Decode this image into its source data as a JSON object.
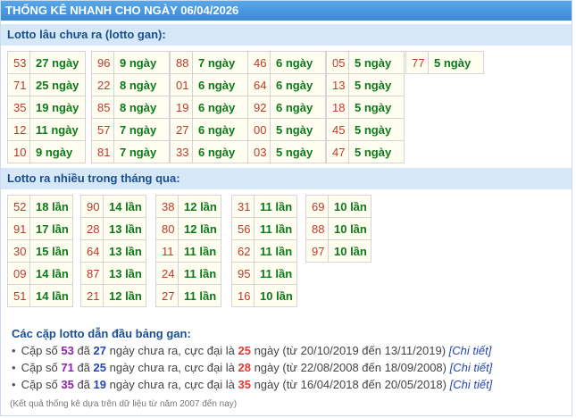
{
  "header": {
    "title": "THỐNG KÊ NHANH CHO NGÀY 06/04/2026"
  },
  "gan": {
    "heading": "Lotto lâu chưa ra (lotto gan):",
    "columns": [
      [
        {
          "num": "53",
          "val": "27 ngày"
        },
        {
          "num": "71",
          "val": "25 ngày"
        },
        {
          "num": "35",
          "val": "19 ngày"
        },
        {
          "num": "12",
          "val": "11 ngày"
        },
        {
          "num": "10",
          "val": "9 ngày"
        }
      ],
      [
        {
          "num": "96",
          "val": "9 ngày"
        },
        {
          "num": "22",
          "val": "8 ngày"
        },
        {
          "num": "85",
          "val": "8 ngày"
        },
        {
          "num": "57",
          "val": "7 ngày"
        },
        {
          "num": "81",
          "val": "7 ngày"
        }
      ],
      [
        {
          "num": "88",
          "val": "7 ngày"
        },
        {
          "num": "01",
          "val": "6 ngày"
        },
        {
          "num": "19",
          "val": "6 ngày"
        },
        {
          "num": "27",
          "val": "6 ngày"
        },
        {
          "num": "33",
          "val": "6 ngày"
        }
      ],
      [
        {
          "num": "46",
          "val": "6 ngày"
        },
        {
          "num": "64",
          "val": "6 ngày"
        },
        {
          "num": "92",
          "val": "6 ngày"
        },
        {
          "num": "00",
          "val": "5 ngày"
        },
        {
          "num": "03",
          "val": "5 ngày"
        }
      ],
      [
        {
          "num": "05",
          "val": "5 ngày"
        },
        {
          "num": "13",
          "val": "5 ngày"
        },
        {
          "num": "18",
          "val": "5 ngày"
        },
        {
          "num": "45",
          "val": "5 ngày"
        },
        {
          "num": "47",
          "val": "5 ngày"
        }
      ],
      [
        {
          "num": "77",
          "val": "5 ngày"
        }
      ]
    ]
  },
  "nhieu": {
    "heading": "Lotto ra nhiều trong tháng qua:",
    "columns": [
      [
        {
          "num": "52",
          "val": "18 lần"
        },
        {
          "num": "91",
          "val": "17 lần"
        },
        {
          "num": "30",
          "val": "15 lần"
        },
        {
          "num": "09",
          "val": "14 lần"
        },
        {
          "num": "51",
          "val": "14 lần"
        }
      ],
      [
        {
          "num": "90",
          "val": "14 lần"
        },
        {
          "num": "28",
          "val": "13 lần"
        },
        {
          "num": "64",
          "val": "13 lần"
        },
        {
          "num": "87",
          "val": "13 lần"
        },
        {
          "num": "21",
          "val": "12 lần"
        }
      ],
      [
        {
          "num": "38",
          "val": "12 lần"
        },
        {
          "num": "80",
          "val": "12 lần"
        },
        {
          "num": "11",
          "val": "11 lần"
        },
        {
          "num": "24",
          "val": "11 lần"
        },
        {
          "num": "27",
          "val": "11 lần"
        }
      ],
      [
        {
          "num": "31",
          "val": "11 lần"
        },
        {
          "num": "56",
          "val": "11 lần"
        },
        {
          "num": "62",
          "val": "11 lần"
        },
        {
          "num": "95",
          "val": "11 lần"
        },
        {
          "num": "16",
          "val": "10 lần"
        }
      ],
      [
        {
          "num": "69",
          "val": "10 lần"
        },
        {
          "num": "88",
          "val": "10 lần"
        },
        {
          "num": "97",
          "val": "10 lần"
        }
      ]
    ]
  },
  "pairs": {
    "heading": "Các cặp lotto dẫn đầu bảng gan:",
    "items": [
      {
        "p1": "Cặp số ",
        "num": "53",
        "p2": " đã ",
        "days": "27",
        "p3": " ngày chưa ra, cực đại là ",
        "max": "25",
        "p4": " ngày (từ 20/10/2019 đến 13/11/2019) ",
        "link": "[Chi tiết]"
      },
      {
        "p1": "Cặp số ",
        "num": "71",
        "p2": " đã ",
        "days": "25",
        "p3": " ngày chưa ra, cực đại là ",
        "max": "28",
        "p4": " ngày (từ 22/08/2008 đến 18/09/2008) ",
        "link": "[Chi tiết]"
      },
      {
        "p1": "Cặp số ",
        "num": "35",
        "p2": " đã ",
        "days": "19",
        "p3": " ngày chưa ra, cực đại là ",
        "max": "35",
        "p4": " ngày (từ 16/04/2018 đến 20/05/2018) ",
        "link": "[Chi tiết]"
      }
    ]
  },
  "footnote": "(Kết quả thống kê dựa trên dữ liệu từ năm 2007 đến nay)",
  "colors": {
    "title_bg": "#3b8ad6",
    "section_bg": "#d6e8f8",
    "cell_bg": "#fffef0",
    "num": "#c0392b",
    "value": "#0b7a1a",
    "pair_num": "#8e24aa",
    "pair_days": "#2346b8",
    "pair_max": "#e53935"
  }
}
